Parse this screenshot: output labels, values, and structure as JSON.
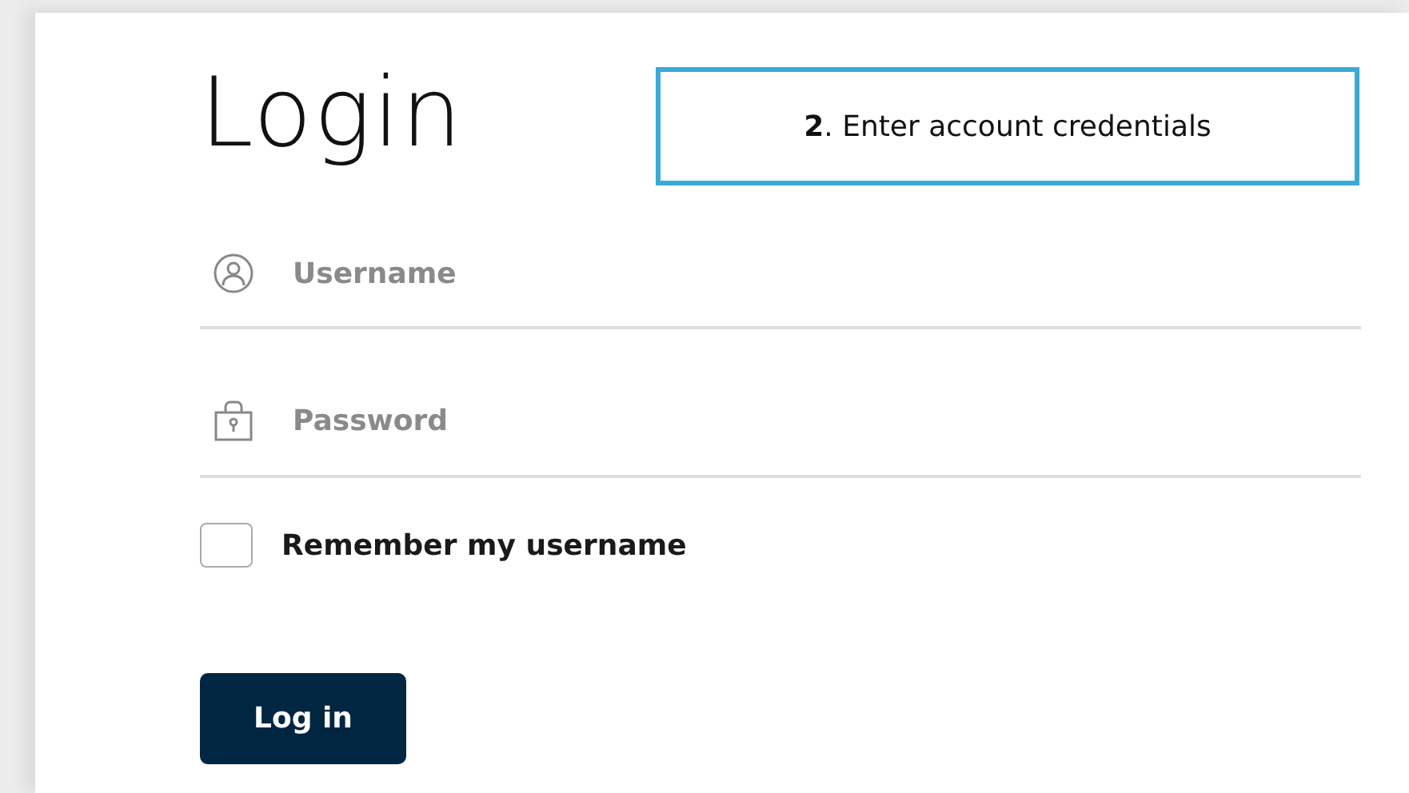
{
  "title": "Login",
  "callout": {
    "text": "**2**. Enter account credentials"
  },
  "fields": [
    {
      "kind": "username",
      "placeholder": "Username"
    },
    {
      "kind": "password",
      "placeholder": "Password"
    }
  ],
  "remember": {
    "label": "Remember my username",
    "checked": false
  },
  "button": {
    "label": "Log in"
  }
}
